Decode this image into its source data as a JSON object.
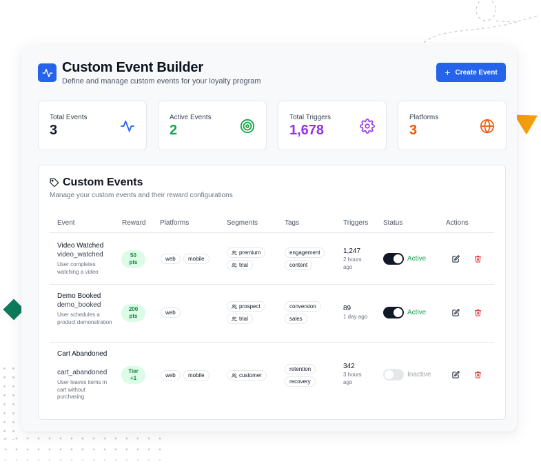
{
  "header": {
    "title": "Custom Event Builder",
    "subtitle": "Define and manage custom events for your loyalty program",
    "create_button": "Create Event",
    "create_icon": "+"
  },
  "stats": [
    {
      "label": "Total Events",
      "value": "3",
      "icon": "activity-icon",
      "color": "#111827",
      "icon_color": "#2563eb"
    },
    {
      "label": "Active Events",
      "value": "2",
      "icon": "target-icon",
      "color": "#16a34a",
      "icon_color": "#16a34a"
    },
    {
      "label": "Total Triggers",
      "value": "1,678",
      "icon": "gear-icon",
      "color": "#9333ea",
      "icon_color": "#9333ea"
    },
    {
      "label": "Platforms",
      "value": "3",
      "icon": "globe-icon",
      "color": "#ea580c",
      "icon_color": "#ea580c"
    }
  ],
  "events_section": {
    "title": "Custom Events",
    "description": "Manage your custom events and their reward configurations",
    "columns": [
      "Event",
      "Reward",
      "Platforms",
      "Segments",
      "Tags",
      "Triggers",
      "Status",
      "Actions"
    ]
  },
  "events": [
    {
      "name": "Video Watched",
      "id": "video_watched",
      "description": "User completes watching a video",
      "reward": [
        "50",
        "pts"
      ],
      "platforms": [
        "web",
        "mobile"
      ],
      "segments": [
        "premium",
        "trial"
      ],
      "tags": [
        "engagement",
        "content"
      ],
      "triggers": "1,247",
      "last_triggered": "2 hours ago",
      "status": "Active",
      "active": true
    },
    {
      "name": "Demo Booked",
      "id": "demo_booked",
      "description": "User schedules a product demonstration",
      "reward": [
        "200",
        "pts"
      ],
      "platforms": [
        "web"
      ],
      "segments": [
        "prospect",
        "trial"
      ],
      "tags": [
        "conversion",
        "sales"
      ],
      "triggers": "89",
      "last_triggered": "1 day ago",
      "status": "Active",
      "active": true
    },
    {
      "name": "Cart Abandoned",
      "id": "cart_abandoned",
      "description": "User leaves items in cart without purchasing",
      "reward": [
        "Tier",
        "+1"
      ],
      "platforms": [
        "web",
        "mobile"
      ],
      "segments": [
        "customer"
      ],
      "tags": [
        "retention",
        "recovery"
      ],
      "triggers": "342",
      "last_triggered": "3 hours ago",
      "status": "Inactive",
      "active": false
    }
  ]
}
